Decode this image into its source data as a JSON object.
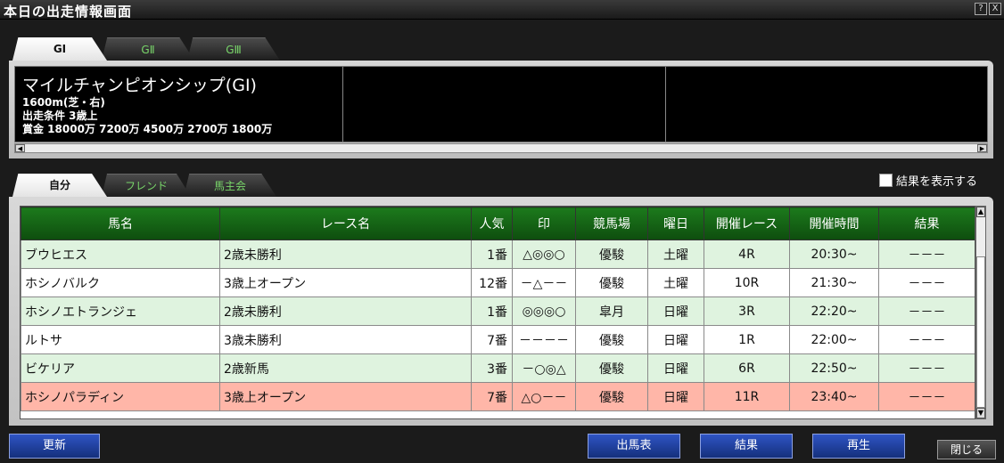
{
  "window": {
    "title": "本日の出走情報画面",
    "help": "?",
    "close": "X"
  },
  "grade_tabs": [
    {
      "label": "GⅠ",
      "active": true
    },
    {
      "label": "GⅡ",
      "active": false
    },
    {
      "label": "GⅢ",
      "active": false
    }
  ],
  "race_info": {
    "name": "マイルチャンピオンシップ(GⅠ)",
    "distance": "1600m(芝・右)",
    "condition": "出走条件 3歳上",
    "prize": "賞金  18000万 7200万 4500万 2700万 1800万"
  },
  "filter_tabs": [
    {
      "label": "自分",
      "active": true
    },
    {
      "label": "フレンド",
      "active": false
    },
    {
      "label": "馬主会",
      "active": false
    }
  ],
  "show_results": {
    "label": "結果を表示する",
    "checked": false
  },
  "table": {
    "headers": [
      "馬名",
      "レース名",
      "人気",
      "印",
      "競馬場",
      "曜日",
      "開催レース",
      "開催時間",
      "結果"
    ],
    "rows": [
      {
        "style": "green",
        "cells": [
          "ブウヒエス",
          "2歳未勝利",
          "1番",
          "△◎◎○",
          "優駿",
          "土曜",
          "4R",
          "20:30~",
          "－－－"
        ]
      },
      {
        "style": "white",
        "cells": [
          "ホシノバルク",
          "3歳上オープン",
          "12番",
          "－△－－",
          "優駿",
          "土曜",
          "10R",
          "21:30~",
          "－－－"
        ]
      },
      {
        "style": "green",
        "cells": [
          "ホシノエトランジェ",
          "2歳未勝利",
          "1番",
          "◎◎◎○",
          "皐月",
          "日曜",
          "3R",
          "22:20~",
          "－－－"
        ]
      },
      {
        "style": "white",
        "cells": [
          "ルトサ",
          "3歳未勝利",
          "7番",
          "－－－－",
          "優駿",
          "日曜",
          "1R",
          "22:00~",
          "－－－"
        ]
      },
      {
        "style": "green",
        "cells": [
          "ビケリア",
          "2歳新馬",
          "3番",
          "－○◎△",
          "優駿",
          "日曜",
          "6R",
          "22:50~",
          "－－－"
        ]
      },
      {
        "style": "pink",
        "cells": [
          "ホシノパラディン",
          "3歳上オープン",
          "7番",
          "△○－－",
          "優駿",
          "日曜",
          "11R",
          "23:40~",
          "－－－"
        ]
      }
    ]
  },
  "buttons": {
    "refresh": "更新",
    "entries": "出馬表",
    "results": "結果",
    "replay": "再生",
    "close": "閉じる"
  },
  "colors": {
    "header_green": "#0e4d0e",
    "row_green": "#dff3df",
    "row_pink": "#ffb6a8",
    "button_blue": "#2f54c4",
    "tab_inactive_text": "#79d66a"
  }
}
